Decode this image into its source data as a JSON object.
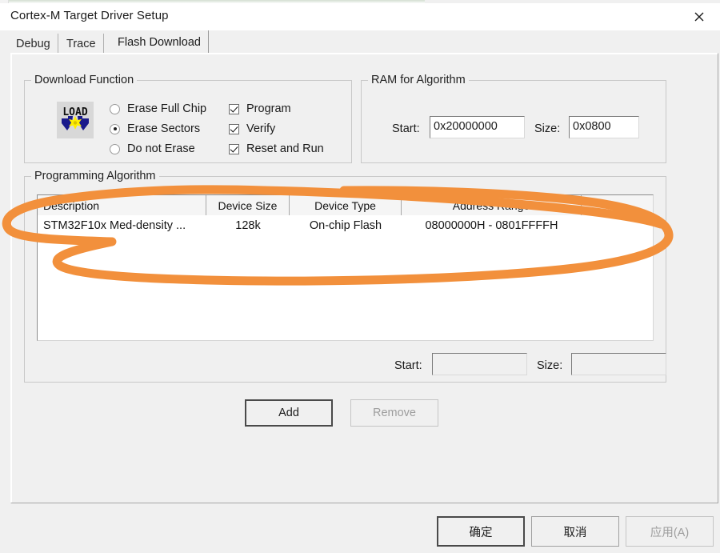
{
  "window": {
    "title": "Cortex-M Target Driver Setup",
    "close_icon": "close-icon"
  },
  "tabs": [
    {
      "label": "Debug",
      "active": false
    },
    {
      "label": "Trace",
      "active": false
    },
    {
      "label": "Flash Download",
      "active": true
    }
  ],
  "download_function": {
    "legend": "Download Function",
    "icon": "load-icon",
    "radios": [
      {
        "label": "Erase Full Chip",
        "selected": false
      },
      {
        "label": "Erase Sectors",
        "selected": true
      },
      {
        "label": "Do not Erase",
        "selected": false
      }
    ],
    "checkboxes": [
      {
        "label": "Program",
        "checked": true
      },
      {
        "label": "Verify",
        "checked": true
      },
      {
        "label": "Reset and Run",
        "checked": true
      }
    ]
  },
  "ram_for_algorithm": {
    "legend": "RAM for Algorithm",
    "start_label": "Start:",
    "start_value": "0x20000000",
    "size_label": "Size:",
    "size_value": "0x0800"
  },
  "programming_algorithm": {
    "legend": "Programming Algorithm",
    "columns": [
      "Description",
      "Device Size",
      "Device Type",
      "Address Range",
      ""
    ],
    "rows": [
      {
        "description": "STM32F10x Med-density ...",
        "device_size": "128k",
        "device_type": "On-chip Flash",
        "address_range": "08000000H - 0801FFFFH",
        "extra": ""
      }
    ],
    "start_label": "Start:",
    "start_value": "",
    "size_label": "Size:",
    "size_value": "",
    "add_label": "Add",
    "remove_label": "Remove"
  },
  "footer": {
    "ok_label": "确定",
    "cancel_label": "取消",
    "apply_label": "应用(A)"
  },
  "annotation": {
    "type": "freehand-ellipse",
    "color": "#F2903C",
    "stroke_width": 11
  }
}
